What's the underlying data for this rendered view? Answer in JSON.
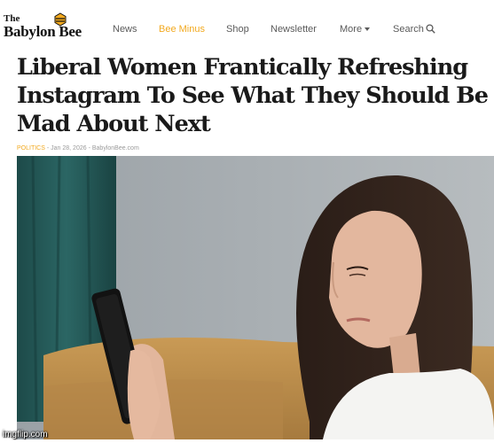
{
  "site": {
    "logo_the": "The",
    "logo_name": "Babylon Bee"
  },
  "nav": {
    "items": [
      {
        "label": "News"
      },
      {
        "label": "Bee Minus"
      },
      {
        "label": "Shop"
      },
      {
        "label": "Newsletter"
      },
      {
        "label": "More"
      },
      {
        "label": "Search"
      }
    ]
  },
  "article": {
    "headline": "Liberal Women Frantically Refreshing Instagram To See What They Should Be Mad About Next",
    "category": "POLITICS",
    "date": "Jan 28, 2026",
    "source": "BabylonBee.com",
    "meta_separator": " - "
  },
  "watermark": "imgflip.com",
  "colors": {
    "accent": "#f2a91f",
    "nav_text": "#5a5a5a",
    "headline": "#1a1a1a"
  },
  "icons": {
    "logo": "bee-hexagon-icon",
    "more": "caret-down-icon",
    "search": "search-icon"
  }
}
